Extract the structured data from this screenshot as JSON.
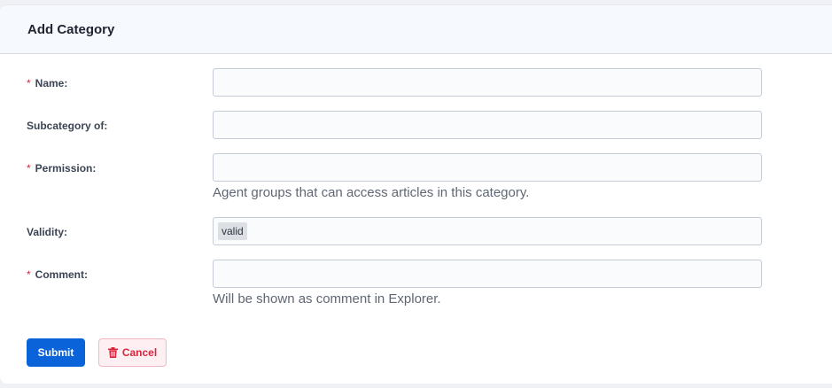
{
  "header": {
    "title": "Add Category"
  },
  "form": {
    "required_mark": "*",
    "name": {
      "label": "Name:",
      "value": "",
      "placeholder": ""
    },
    "subcategory": {
      "label": "Subcategory of:",
      "value": "",
      "placeholder": ""
    },
    "permission": {
      "label": "Permission:",
      "value": "",
      "hint": "Agent groups that can access articles in this category."
    },
    "validity": {
      "label": "Validity:",
      "selected": "valid"
    },
    "comment": {
      "label": "Comment:",
      "value": "",
      "hint": "Will be shown as comment in Explorer."
    }
  },
  "actions": {
    "submit_label": "Submit",
    "cancel_label": "Cancel",
    "cancel_icon": "trash-icon"
  },
  "colors": {
    "primary": "#0a63d8",
    "danger": "#d7263d"
  }
}
